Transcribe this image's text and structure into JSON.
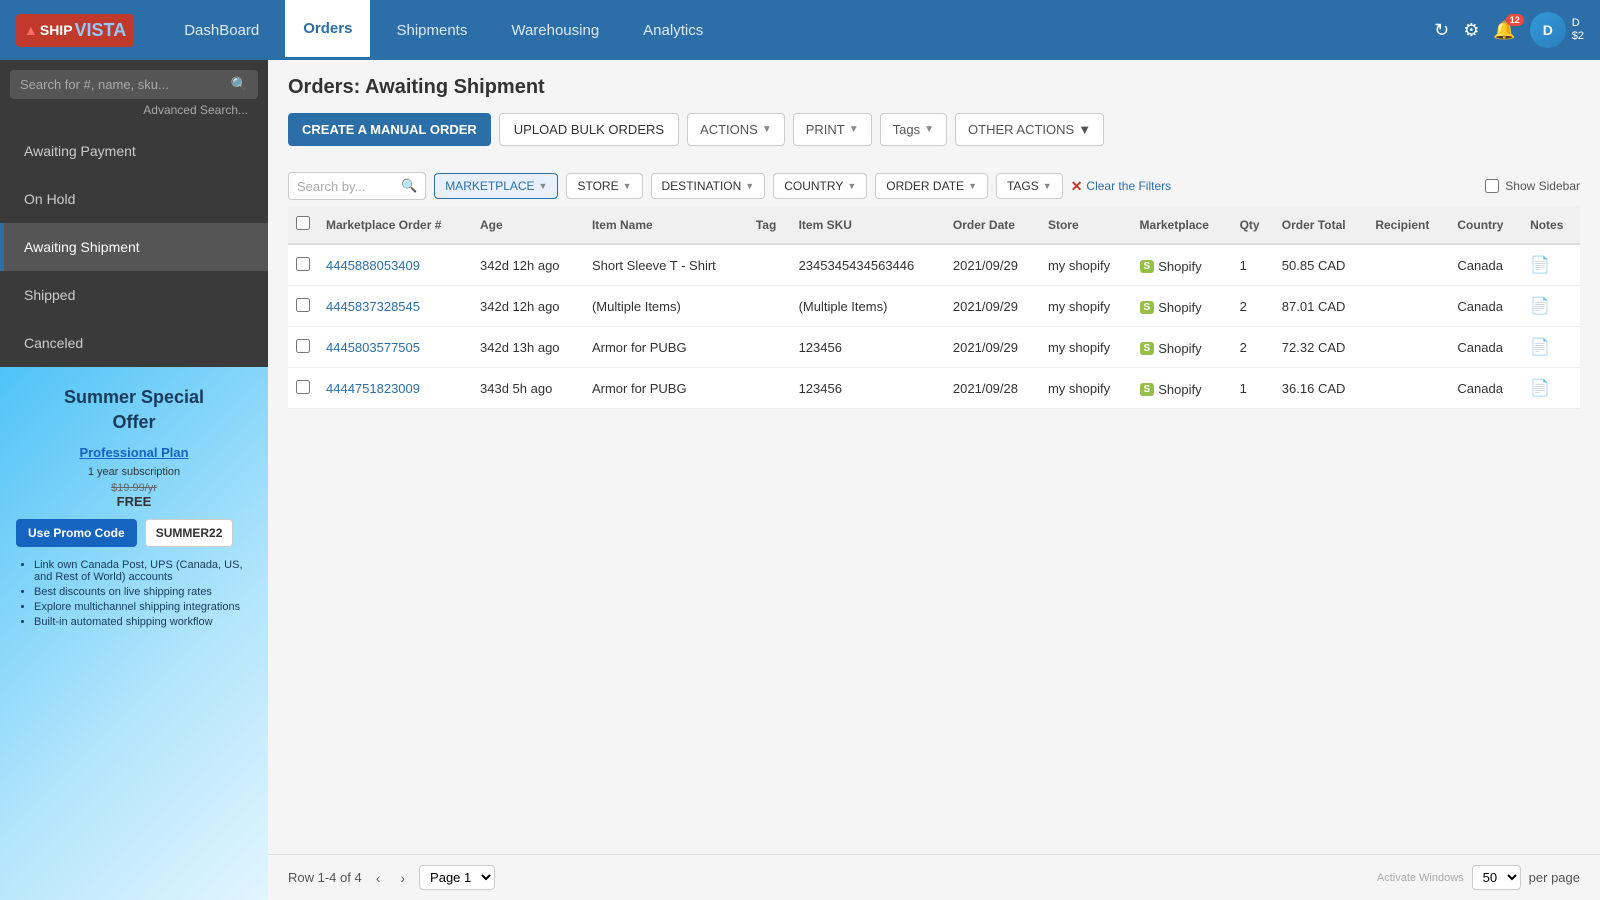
{
  "app": {
    "name": "SHIPVISTA"
  },
  "nav": {
    "items": [
      {
        "label": "DashBoard",
        "active": false
      },
      {
        "label": "Orders",
        "active": true
      },
      {
        "label": "Shipments",
        "active": false
      },
      {
        "label": "Warehousing",
        "active": false
      },
      {
        "label": "Analytics",
        "active": false
      }
    ],
    "notification_count": "12",
    "user_label": "D",
    "user_balance": "$2"
  },
  "sidebar": {
    "search_placeholder": "Search for #, name, sku...",
    "advanced_search": "Advanced Search...",
    "nav_items": [
      {
        "label": "Awaiting Payment",
        "active": false
      },
      {
        "label": "On Hold",
        "active": false
      },
      {
        "label": "Awaiting Shipment",
        "active": true
      },
      {
        "label": "Shipped",
        "active": false
      },
      {
        "label": "Canceled",
        "active": false
      }
    ]
  },
  "promo": {
    "title": "Summer Special",
    "subtitle": "Offer",
    "plan": "Professional Plan",
    "subscription": "1 year subscription",
    "old_price": "$19.99/yr",
    "free": "FREE",
    "use_promo_label": "Use Promo Code",
    "promo_code": "SUMMER22",
    "bullets": [
      "Link own Canada Post, UPS (Canada, US, and Rest of World) accounts",
      "Best discounts on live shipping rates",
      "Explore multichannel shipping integrations",
      "Built-in automated shipping workflow"
    ]
  },
  "main": {
    "page_title": "Orders: Awaiting Shipment",
    "toolbar": {
      "create_label": "CREATE A MANUAL ORDER",
      "upload_label": "UPLOAD BULK ORDERS",
      "actions_label": "ACTIONS",
      "print_label": "PRINT",
      "tags_label": "Tags",
      "other_actions_label": "OTHER ACTIONS"
    },
    "filters": {
      "search_placeholder": "Search by...",
      "marketplace_label": "MARKETPLACE",
      "store_label": "STORE",
      "destination_label": "DESTINATION",
      "country_label": "COUNTRY",
      "order_date_label": "ORDER DATE",
      "tags_label": "TAGS",
      "clear_label": "Clear the Filters",
      "show_sidebar_label": "Show Sidebar"
    },
    "table": {
      "columns": [
        "Marketplace Order #",
        "Age",
        "Item Name",
        "Tag",
        "Item SKU",
        "Order Date",
        "Store",
        "Marketplace",
        "Qty",
        "Order Total",
        "Recipient",
        "Country",
        "Notes"
      ],
      "rows": [
        {
          "id": "4445888053409",
          "age": "342d 12h ago",
          "item_name": "Short Sleeve T - Shirt",
          "tag": "",
          "sku": "2345345434563446",
          "order_date": "2021/09/29",
          "store": "my shopify",
          "marketplace": "Shopify",
          "qty": "1",
          "total": "50.85 CAD",
          "recipient": "",
          "country": "Canada",
          "has_note": true
        },
        {
          "id": "4445837328545",
          "age": "342d 12h ago",
          "item_name": "(Multiple Items)",
          "tag": "",
          "sku": "(Multiple Items)",
          "order_date": "2021/09/29",
          "store": "my shopify",
          "marketplace": "Shopify",
          "qty": "2",
          "total": "87.01 CAD",
          "recipient": "",
          "country": "Canada",
          "has_note": true
        },
        {
          "id": "4445803577505",
          "age": "342d 13h ago",
          "item_name": "Armor for PUBG",
          "tag": "",
          "sku": "123456",
          "order_date": "2021/09/29",
          "store": "my shopify",
          "marketplace": "Shopify",
          "qty": "2",
          "total": "72.32 CAD",
          "recipient": "",
          "country": "Canada",
          "has_note": true
        },
        {
          "id": "4444751823009",
          "age": "343d 5h ago",
          "item_name": "Armor for PUBG",
          "tag": "",
          "sku": "123456",
          "order_date": "2021/09/28",
          "store": "my shopify",
          "marketplace": "Shopify",
          "qty": "1",
          "total": "36.16 CAD",
          "recipient": "",
          "country": "Canada",
          "has_note": true
        }
      ]
    },
    "pagination": {
      "row_info": "Row 1-4 of 4",
      "page_label": "Page 1",
      "per_page": "50",
      "per_page_suffix": "per page"
    }
  }
}
